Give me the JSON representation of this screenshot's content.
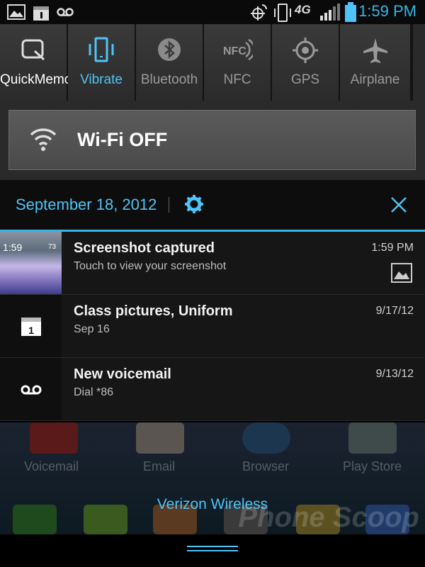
{
  "status_bar": {
    "time": "1:59 PM",
    "network": "4G",
    "icons": [
      "gallery-icon",
      "calendar-icon",
      "voicemail-icon",
      "gps-icon",
      "vibrate-icon",
      "signal-icon",
      "battery-icon"
    ]
  },
  "quick_settings": [
    {
      "label": "QuickMemo",
      "icon": "quickmemo-icon",
      "active": false
    },
    {
      "label": "Vibrate",
      "icon": "vibrate-icon",
      "active": true
    },
    {
      "label": "Bluetooth",
      "icon": "bluetooth-icon",
      "active": false
    },
    {
      "label": "NFC",
      "icon": "nfc-icon",
      "active": false
    },
    {
      "label": "GPS",
      "icon": "gps-icon",
      "active": false
    },
    {
      "label": "Airplane",
      "icon": "airplane-icon",
      "active": false
    }
  ],
  "wifi": {
    "label": "Wi-Fi OFF"
  },
  "date_bar": {
    "date": "September 18, 2012"
  },
  "notifications": [
    {
      "title": "Screenshot captured",
      "subtitle": "Touch to view your screenshot",
      "time": "1:59 PM"
    },
    {
      "title": "Class pictures, Uniform",
      "subtitle": "Sep 16",
      "time": "9/17/12"
    },
    {
      "title": "New voicemail",
      "subtitle": "Dial *86",
      "time": "9/13/12"
    }
  ],
  "thumb": {
    "time": "1:59",
    "temp": "73"
  },
  "calendar_day": "1",
  "home": {
    "apps": [
      "Voicemail",
      "Email",
      "Browser",
      "Play Store"
    ],
    "carrier": "Verizon Wireless"
  },
  "watermark": "Phone Scoop",
  "colors": {
    "accent": "#35b5e5",
    "background": "#000000"
  }
}
